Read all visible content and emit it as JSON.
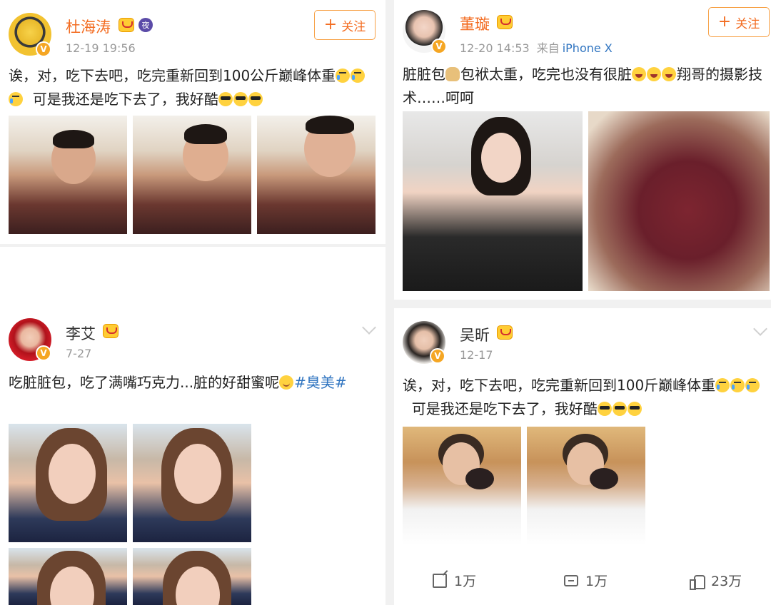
{
  "posts": [
    {
      "username": "杜海涛",
      "time": "12-19 19:56",
      "follow_label": "关注",
      "text_parts": [
        "诶，对，吃下去吧，吃完重新回到100公斤巅峰体重",
        "可是我还是吃下去了，我好酷"
      ],
      "emoji_a": "crying-laughing",
      "emoji_b": "sunglasses",
      "images": [
        "man-eating-photo-1",
        "man-eating-photo-2",
        "man-eating-photo-3"
      ]
    },
    {
      "username": "董璇",
      "time": "12-20 14:53",
      "source_label": "来自",
      "device": "iPhone X",
      "follow_label": "关注",
      "text_parts": [
        "脏脏包",
        "包袱太重，吃完也没有很脏",
        "翔哥的摄影技术……呵呵"
      ],
      "images": [
        "woman-eating-photo",
        "chocolate-bread-photo"
      ]
    },
    {
      "username": "李艾",
      "time": "7-27",
      "text_before": "吃脏脏包，吃了满嘴巧克力...脏的好甜蜜呢",
      "hashtag": "#臭美#",
      "images": [
        "selfie-1",
        "selfie-2",
        "selfie-3",
        "selfie-4"
      ]
    },
    {
      "username": "吴昕",
      "time": "12-17",
      "text_parts": [
        "诶，对，吃下去吧，吃完重新回到100斤巅峰体重",
        "可是我还是吃下去了，我好酷"
      ],
      "images": [
        "woman-bathrobe-photo-1",
        "woman-bathrobe-photo-2"
      ],
      "actions": {
        "repost_count": "1万",
        "comment_count": "1万",
        "like_count": "23万"
      }
    }
  ],
  "colors": {
    "username_orange": "#f36c21",
    "link_blue": "#2f74c0",
    "meta_gray": "#999999"
  }
}
